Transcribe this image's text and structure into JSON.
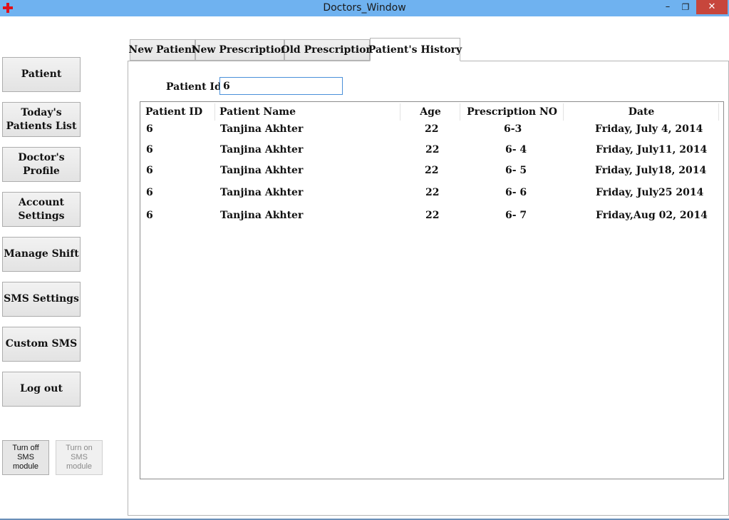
{
  "window": {
    "title": "Doctors_Window",
    "minimize": "–",
    "maximize": "❐",
    "close": "✕"
  },
  "sidebar": {
    "buttons": [
      {
        "label": "Patient"
      },
      {
        "label": "Today's\nPatients List"
      },
      {
        "label": "Doctor's\nProfile"
      },
      {
        "label": "Account\nSettings"
      },
      {
        "label": "Manage Shift"
      },
      {
        "label": "SMS Settings"
      },
      {
        "label": "Custom SMS"
      },
      {
        "label": "Log out"
      }
    ],
    "sms_off": "Turn off\nSMS\nmodule",
    "sms_on": "Turn on\nSMS\nmodule"
  },
  "tabs": [
    {
      "label": "New Patient"
    },
    {
      "label": "New Prescription"
    },
    {
      "label": "Old Prescription"
    },
    {
      "label": "Patient's History"
    }
  ],
  "history": {
    "patient_id_label": "Patient Id:",
    "patient_id_value": "6",
    "columns": [
      "Patient ID",
      "Patient Name",
      "Age",
      "Prescription NO",
      "Date"
    ],
    "rows": [
      [
        "6",
        "Tanjina Akhter",
        "22",
        "6-3",
        "Friday, July 4, 2014"
      ],
      [
        "6",
        "Tanjina Akhter",
        "22",
        "6- 4",
        "Friday, July11, 2014"
      ],
      [
        "6",
        "Tanjina Akhter",
        "22",
        "6- 5",
        "Friday, July18, 2014"
      ],
      [
        "6",
        "Tanjina Akhter",
        "22",
        "6- 6",
        "Friday, July25 2014"
      ],
      [
        "6",
        "Tanjina Akhter",
        "22",
        "6- 7",
        "Friday,Aug 02, 2014"
      ]
    ]
  }
}
